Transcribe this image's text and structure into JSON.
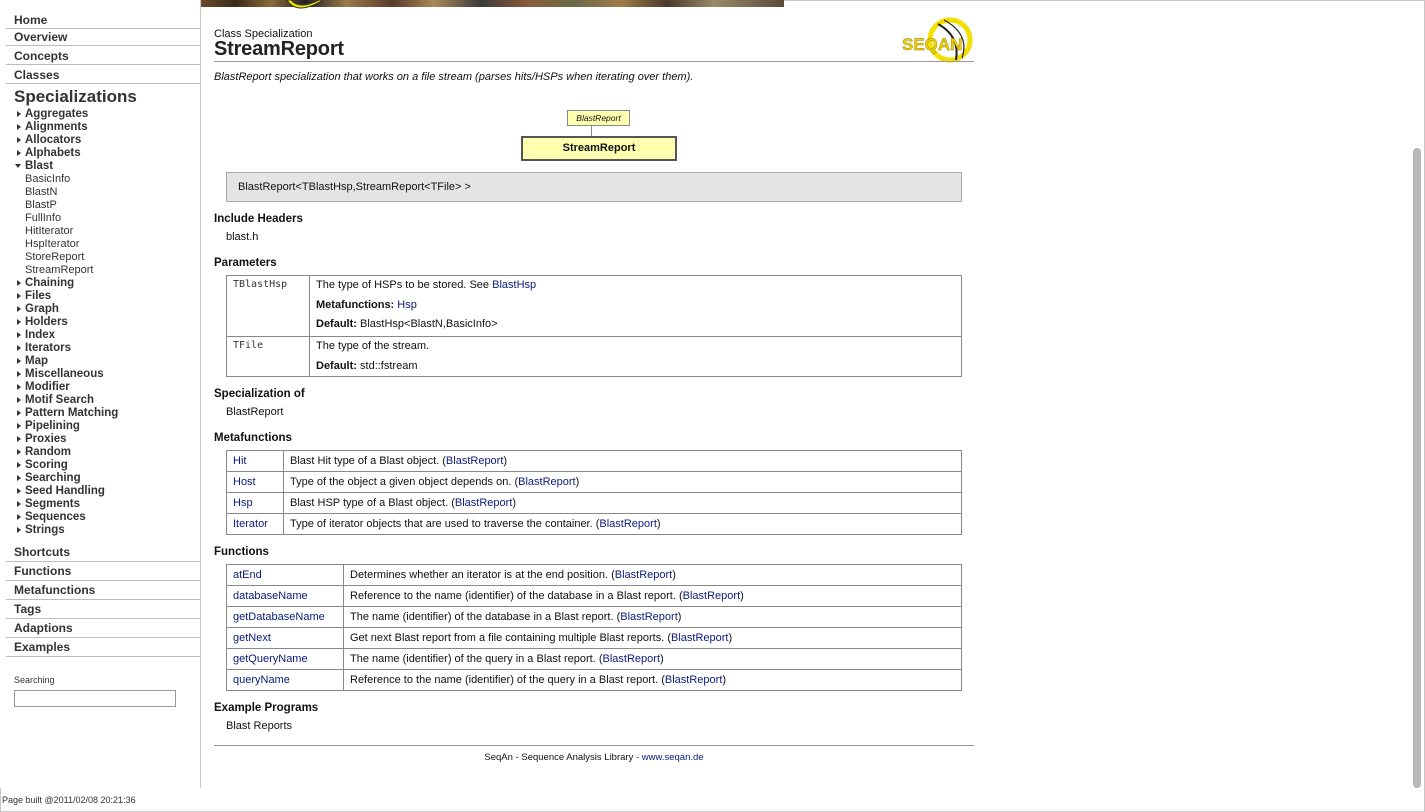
{
  "sidebar": {
    "nav_top": [
      "Home",
      "Overview",
      "Concepts",
      "Classes"
    ],
    "specializations_title": "Specializations",
    "tree": [
      {
        "label": "Aggregates",
        "open": false
      },
      {
        "label": "Alignments",
        "open": false
      },
      {
        "label": "Allocators",
        "open": false
      },
      {
        "label": "Alphabets",
        "open": false
      },
      {
        "label": "Blast",
        "open": true,
        "children": [
          "BasicInfo",
          "BlastN",
          "BlastP",
          "FullInfo",
          "HitIterator",
          "HspIterator",
          "StoreReport",
          "StreamReport"
        ]
      },
      {
        "label": "Chaining",
        "open": false
      },
      {
        "label": "Files",
        "open": false
      },
      {
        "label": "Graph",
        "open": false
      },
      {
        "label": "Holders",
        "open": false
      },
      {
        "label": "Index",
        "open": false
      },
      {
        "label": "Iterators",
        "open": false
      },
      {
        "label": "Map",
        "open": false
      },
      {
        "label": "Miscellaneous",
        "open": false
      },
      {
        "label": "Modifier",
        "open": false
      },
      {
        "label": "Motif Search",
        "open": false
      },
      {
        "label": "Pattern Matching",
        "open": false
      },
      {
        "label": "Pipelining",
        "open": false
      },
      {
        "label": "Proxies",
        "open": false
      },
      {
        "label": "Random",
        "open": false
      },
      {
        "label": "Scoring",
        "open": false
      },
      {
        "label": "Searching",
        "open": false
      },
      {
        "label": "Seed Handling",
        "open": false
      },
      {
        "label": "Segments",
        "open": false
      },
      {
        "label": "Sequences",
        "open": false
      },
      {
        "label": "Strings",
        "open": false
      }
    ],
    "nav_bottom": [
      "Shortcuts",
      "Functions",
      "Metafunctions",
      "Tags",
      "Adaptions",
      "Examples"
    ],
    "search_label": "Searching",
    "search_value": "",
    "page_built": "Page built @2011/02/08 20:21:36"
  },
  "header": {
    "kind": "Class Specialization",
    "title": "StreamReport",
    "logo_text": "SEQAN",
    "description": "BlastReport specialization that works on a file stream (parses hits/HSPs when iterating over them)."
  },
  "diagram": {
    "parent": "BlastReport",
    "child": "StreamReport"
  },
  "signature": "BlastReport<TBlastHsp,StreamReport<TFile> >",
  "include_headers": {
    "heading": "Include Headers",
    "value": "blast.h"
  },
  "parameters": {
    "heading": "Parameters",
    "rows": [
      {
        "name": "TBlastHsp",
        "desc": "The type of HSPs to be stored. See ",
        "desc_link": "BlastHsp",
        "meta_label": "Metafunctions:",
        "meta_link": "Hsp",
        "default_label": "Default:",
        "default_value": "BlastHsp<BlastN,BasicInfo>"
      },
      {
        "name": "TFile",
        "desc": "The type of the stream.",
        "default_label": "Default:",
        "default_value": "std::fstream"
      }
    ]
  },
  "specialization_of": {
    "heading": "Specialization of",
    "link": "BlastReport"
  },
  "metafunctions": {
    "heading": "Metafunctions",
    "rows": [
      {
        "name": "Hit",
        "desc": "Blast Hit type of a Blast object.",
        "ref": "BlastReport"
      },
      {
        "name": "Host",
        "desc": "Type of the object a given object depends on.",
        "ref": "BlastReport"
      },
      {
        "name": "Hsp",
        "desc": "Blast HSP type of a Blast object.",
        "ref": "BlastReport"
      },
      {
        "name": "Iterator",
        "desc": "Type of iterator objects that are used to traverse the container.",
        "ref": "BlastReport"
      }
    ]
  },
  "functions": {
    "heading": "Functions",
    "rows": [
      {
        "name": "atEnd",
        "desc": "Determines whether an iterator is at the end position.",
        "ref": "BlastReport"
      },
      {
        "name": "databaseName",
        "desc": "Reference to the name (identifier) of the database in a Blast report.",
        "ref": "BlastReport"
      },
      {
        "name": "getDatabaseName",
        "desc": "The name (identifier) of the database in a Blast report.",
        "ref": "BlastReport"
      },
      {
        "name": "getNext",
        "desc": "Get next Blast report from a file containing multiple Blast reports.",
        "ref": "BlastReport"
      },
      {
        "name": "getQueryName",
        "desc": "The name (identifier) of the query in a Blast report.",
        "ref": "BlastReport"
      },
      {
        "name": "queryName",
        "desc": "Reference to the name (identifier) of the query in a Blast report.",
        "ref": "BlastReport"
      }
    ]
  },
  "example_programs": {
    "heading": "Example Programs",
    "link": "Blast Reports"
  },
  "footer": {
    "text": "SeqAn - Sequence Analysis Library - ",
    "link": "www.seqan.de"
  }
}
